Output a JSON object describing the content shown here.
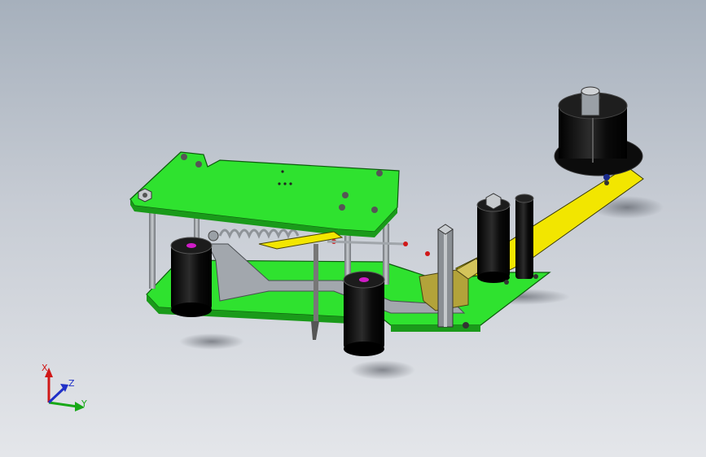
{
  "viewport": {
    "background_top": "#a6b0bc",
    "background_bottom": "#e4e6ea"
  },
  "colors": {
    "plate_green": "#2fe22f",
    "plate_green_dark": "#1a9a1a",
    "arm_yellow": "#f2e600",
    "roller_black": "#111111",
    "steel_gray": "#9aa0a6",
    "bracket_olive": "#b3a33a",
    "accent_magenta": "#d01cc8",
    "accent_red": "#d01818"
  },
  "triad": {
    "x_label": "X",
    "y_label": "Y",
    "z_label": "Z",
    "x_color": "#d01818",
    "y_color": "#18a818",
    "z_color": "#2030c8"
  }
}
